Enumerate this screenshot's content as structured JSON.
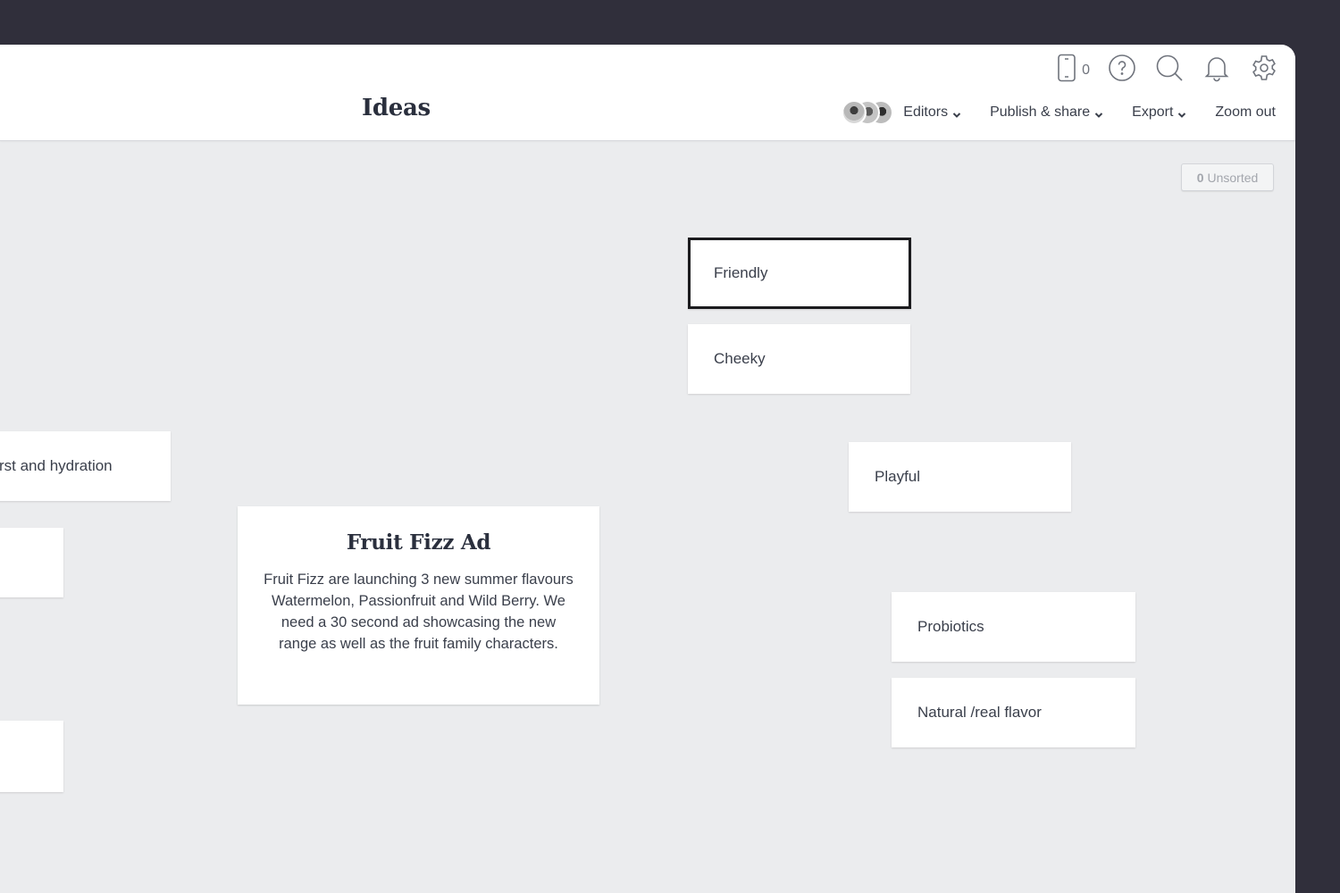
{
  "header": {
    "title": "Ideas",
    "device_count": "0",
    "icons": {
      "device": "phone-icon",
      "help": "help-icon",
      "search": "search-icon",
      "notifications": "bell-icon",
      "settings": "gear-icon"
    },
    "menu": {
      "editors_label": "Editors",
      "publish_label": "Publish & share",
      "export_label": "Export",
      "zoom_label": "Zoom out"
    }
  },
  "canvas": {
    "unsorted": {
      "count": "0",
      "label": "Unsorted"
    },
    "brief": {
      "title": "Fruit Fizz Ad",
      "body": "Fruit Fizz are launching 3 new summer flavours Watermelon, Passionfruit and Wild Berry. We need a 30 second ad showcasing the new range as well as the fruit family characters."
    },
    "cards": [
      {
        "text": "Friendly",
        "selected": true
      },
      {
        "text": "Cheeky"
      },
      {
        "text": "Playful"
      },
      {
        "text": "Probiotics"
      },
      {
        "text": "Natural /real flavor"
      },
      {
        "text": "rst and hydration"
      },
      {
        "text": ""
      },
      {
        "text": ""
      }
    ]
  },
  "colors": {
    "frame": "#302f3b",
    "canvas": "#ebecee",
    "header": "#ffffff",
    "text": "#3a3f4b",
    "selected_border": "#1b1b1e"
  }
}
